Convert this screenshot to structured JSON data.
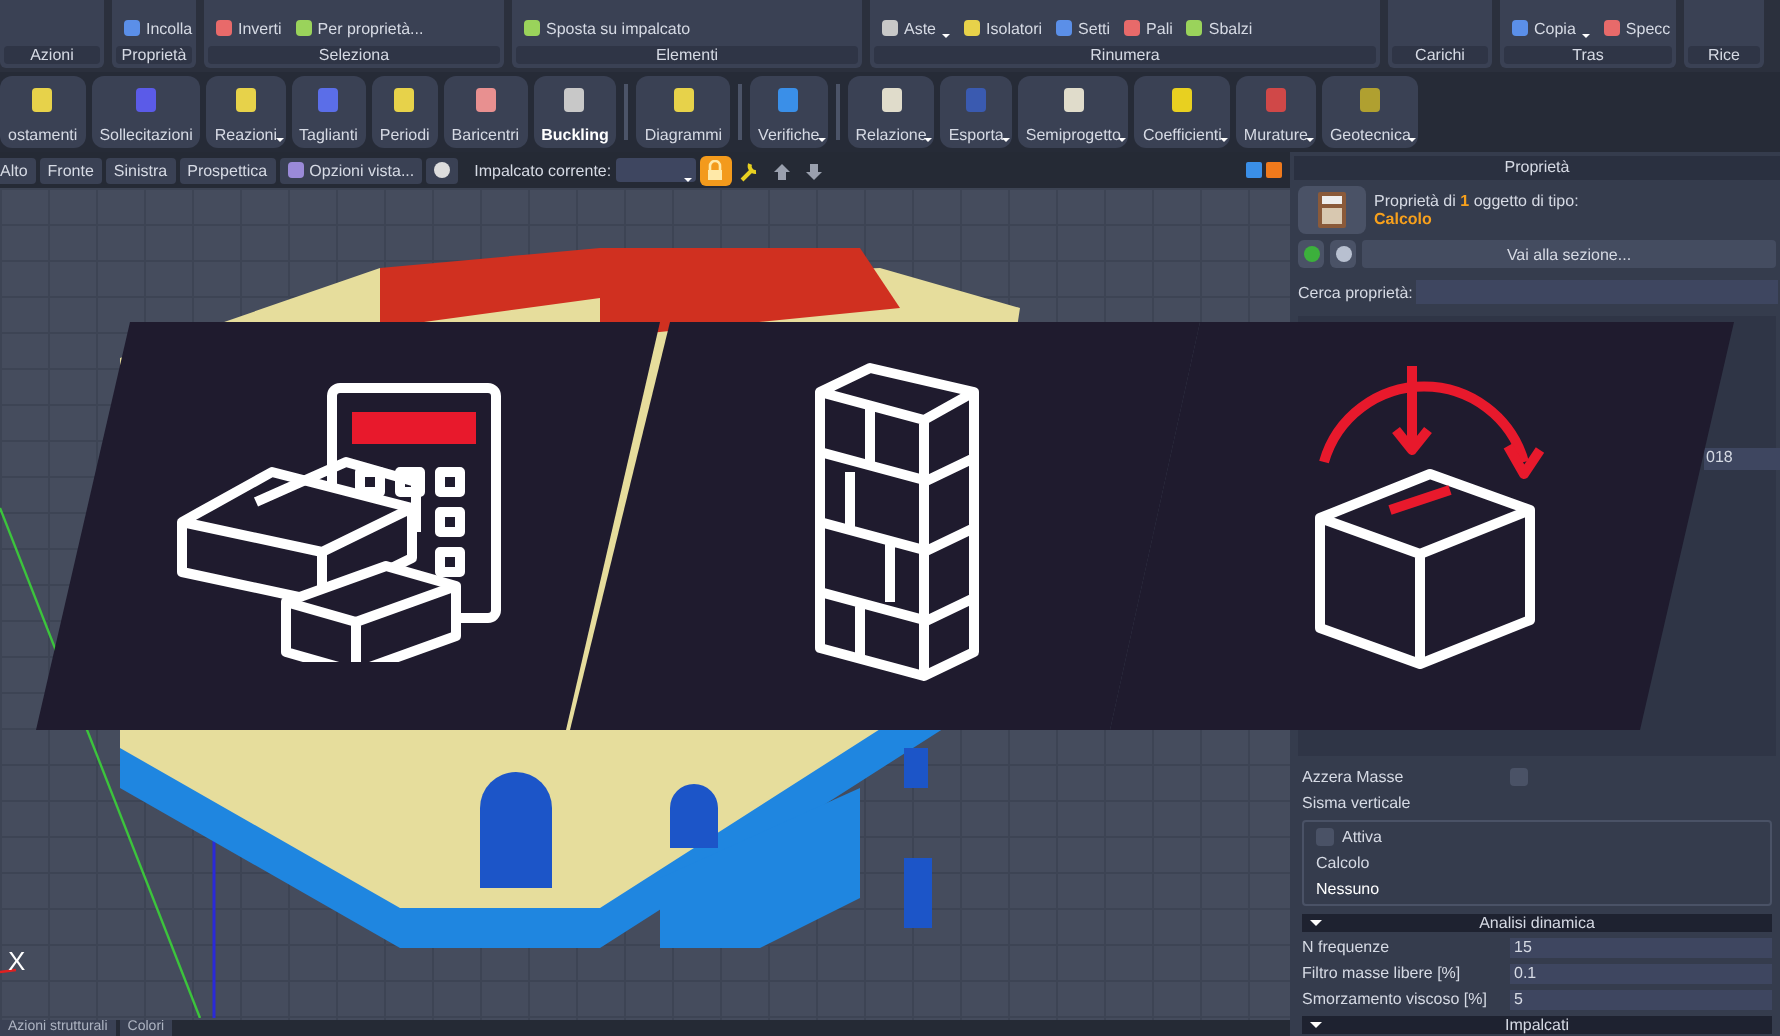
{
  "ribbon": {
    "groups": [
      {
        "label": "Azioni"
      },
      {
        "label": "Proprietà",
        "items": [
          {
            "label": "Incolla",
            "menu": false
          }
        ]
      },
      {
        "label": "Seleziona",
        "items": [
          {
            "label": "Inverti",
            "menu": false
          },
          {
            "label": "Per proprietà...",
            "menu": false
          }
        ]
      },
      {
        "label": "Elementi",
        "items": [
          {
            "label": "Sposta su impalcato",
            "menu": false
          }
        ]
      },
      {
        "label": "Rinumera",
        "items": [
          {
            "label": "Aste",
            "menu": true
          },
          {
            "label": "Isolatori",
            "menu": false
          },
          {
            "label": "Setti",
            "menu": false
          },
          {
            "label": "Pali",
            "menu": false
          },
          {
            "label": "Sbalzi",
            "menu": false
          }
        ]
      },
      {
        "label": "Carichi"
      },
      {
        "label": "Tras",
        "items": [
          {
            "label": "Copia",
            "menu": true
          },
          {
            "label": "Specc",
            "menu": false
          }
        ]
      },
      {
        "label": "Rice"
      }
    ]
  },
  "toolbar": [
    {
      "label": "ostamenti",
      "menu": false,
      "selected": false
    },
    {
      "label": "Sollecitazioni",
      "menu": false,
      "selected": false
    },
    {
      "label": "Reazioni",
      "menu": true,
      "selected": false
    },
    {
      "label": "Taglianti",
      "menu": false,
      "selected": false
    },
    {
      "label": "Periodi",
      "menu": false,
      "selected": false
    },
    {
      "label": "Baricentri",
      "menu": false,
      "selected": false
    },
    {
      "label": "Buckling",
      "menu": false,
      "selected": true
    },
    {
      "label": "Diagrammi",
      "menu": false,
      "selected": false
    },
    {
      "label": "Verifiche",
      "menu": true,
      "selected": false
    },
    {
      "label": "Relazione",
      "menu": true,
      "selected": false
    },
    {
      "label": "Esporta",
      "menu": true,
      "selected": false
    },
    {
      "label": "Semiprogetto",
      "menu": true,
      "selected": false
    },
    {
      "label": "Coefficienti",
      "menu": true,
      "selected": false
    },
    {
      "label": "Murature",
      "menu": true,
      "selected": false
    },
    {
      "label": "Geotecnica",
      "menu": true,
      "selected": false
    }
  ],
  "view_bar": {
    "views": [
      "Alto",
      "Fronte",
      "Sinistra",
      "Prospettica"
    ],
    "options": "Opzioni vista...",
    "floor_label": "Impalcato corrente:",
    "locked": true
  },
  "viewport": {
    "axis_label": "X"
  },
  "bottom_tabs": [
    "Azioni strutturali",
    "Colori"
  ],
  "properties": {
    "title": "Proprietà",
    "summary": "Proprietà di **1** oggetto di tipo:",
    "type": "Calcolo",
    "goto": "Vai alla sezione...",
    "search_label": "Cerca proprietà:",
    "partial_value": "018",
    "azzera_label": "Azzera Masse",
    "azzera_checked": false,
    "sisma_label": "Sisma verticale",
    "sisma": {
      "attiva_label": "Attiva",
      "checked": false,
      "calcolo_label": "Calcolo",
      "calcolo_value": "Nessuno"
    },
    "sections": [
      {
        "title": "Analisi dinamica",
        "rows": [
          {
            "label": "N frequenze",
            "value": "15"
          },
          {
            "label": "Filtro masse libere [%]",
            "value": "0.1"
          },
          {
            "label": "Smorzamento viscoso [%]",
            "value": "5"
          }
        ]
      },
      {
        "title": "Impalcati"
      }
    ]
  }
}
